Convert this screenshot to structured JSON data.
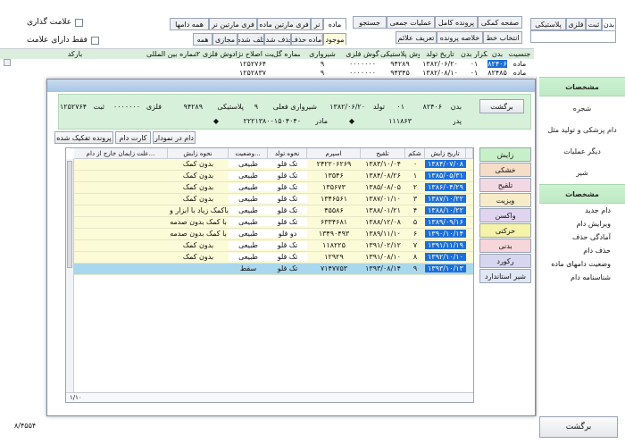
{
  "filters": {
    "tab_bar": [
      "بدن",
      "ثبت",
      "فلزی",
      "پلاستیکی"
    ],
    "tab2": [
      "صفحه کمکی",
      "پرونده کامل",
      "عملیات جمعی",
      "جستجو"
    ],
    "tab3": [
      "انتخاب خط",
      "خلاصه پرونده",
      "تعریف علائم"
    ],
    "scope": [
      "همه دامها",
      "فری مارتین نر",
      "فری مارتین ماده",
      "نر",
      "ماده"
    ],
    "scope2": [
      "همه",
      "مجازی",
      "تلف شده",
      "حذف شده",
      "آماده حذف",
      "موجود"
    ],
    "check1": "علامت گذاری",
    "check2": "فقط دارای علامت"
  },
  "top_grid": {
    "headers": [
      "جنسیت",
      "بدن",
      "تکرار بدن",
      "تاریخ تولد",
      "گوش پلاستیکی",
      "گوش فلزی",
      "شیرواری",
      "شماره گل",
      "ثبت اصلاح نژاد",
      "گوش فلزی ۲",
      "شماره بین المللی",
      "بارکد"
    ],
    "rows": [
      [
        "ماده",
        "۸۲۴۰۶",
        "۰۱",
        "۱۳۸۲/۰۶/۲۰",
        "۹۴۲۸۹",
        "۰۰۰۰۰۰۰",
        "۹",
        "",
        "۱۲۵۲۷۶۴",
        "",
        "",
        ""
      ],
      [
        "ماده",
        "۸۲۴۸۵",
        "۰۱",
        "۱۳۸۲/۰۸/۱۰",
        "۹۴۳۴۵",
        "۰۰۰۰۰۰۰",
        "۹",
        "",
        "۱۲۵۲۸۳۷",
        "",
        "",
        ""
      ]
    ]
  },
  "sidebar": {
    "items": [
      {
        "label": "مشخصات",
        "header": true
      },
      {
        "label": "شجره",
        "header": false
      },
      {
        "label": "دام پزشکی و تولید مثل",
        "header": false
      },
      {
        "label": "دیگر عملیات",
        "header": false
      },
      {
        "label": "شیر",
        "header": false
      },
      {
        "label": "مشخصات",
        "header": true
      }
    ],
    "links": [
      "دام جدید",
      "ویرایش دام",
      "آمادگی حذف",
      "حذف دام",
      "وضعیت دامهای ماده",
      "شناسنامه دام"
    ],
    "return": "برگشت"
  },
  "footer": {
    "count": "۸/۴۵۵۴"
  },
  "dialog": {
    "back": "برگشت",
    "info": {
      "row1": {
        "body_label": "بدن",
        "body": "۸۲۴۰۶",
        "rep": "۰۱",
        "birth_label": "تولد",
        "birth": "۱۳۸۲/۰۶/۲۰",
        "milk_label": "شیرواری فعلی",
        "milk": "۹",
        "plastic_label": "پلاستیکی",
        "plastic": "۹۴۲۸۹",
        "metal_label": "فلزی",
        "metal": "۰۰۰۰۰۰۰",
        "reg_label": "ثبت",
        "reg": "۱۲۵۲۷۶۴"
      },
      "row2": {
        "father_label": "پدر",
        "father": "۱۱۱۸۶۳",
        "mother_label": "مادر",
        "mother": "۲۲۲۱۳۸۰۰۱۵۰۴۰۴۰"
      }
    },
    "tabs": [
      "پرونده تفکیک شده",
      "کارت دام",
      "دام در نمودار"
    ],
    "columns": [
      "",
      "تاریخ زایش",
      "شکم",
      "تلقیح",
      "اسپرم",
      "نحوه تولد",
      "وضعیت...",
      "نحوه زایش",
      "علت زایمان خارج از دام..."
    ],
    "rows": [
      [
        "",
        "۱۳۸۴/۰۷/۰۸",
        "۰",
        "۱۳۸۳/۱۰/۰۴",
        "۲۴۲۲۰۶۲۶۹",
        "تک قلو",
        "طبیعی",
        "بدون کمک",
        ""
      ],
      [
        "",
        "۱۳۸۵/۰۵/۳۱",
        "۱",
        "۱۳۸۴/۰۸/۲۶",
        "۱۳۵۴۶",
        "تک قلو",
        "طبیعی",
        "بدون کمک",
        ""
      ],
      [
        "",
        "۱۳۸۶/۰۴/۲۹",
        "۲",
        "۱۳۸۵/۰۸/۰۵",
        "۱۳۵۶۷۳",
        "تک قلو",
        "طبیعی",
        "بدون کمک",
        ""
      ],
      [
        "",
        "۱۳۸۷/۱۰/۲۲",
        "۳",
        "۱۳۸۷/۰۱/۱۰",
        "۱۳۴۶۵۶۱",
        "تک قلو",
        "طبیعی",
        "بدون کمک",
        ""
      ],
      [
        "",
        "۱۳۸۸/۱۰/۲۲",
        "۴",
        "۱۳۸۸/۰۱/۲۱",
        "۴۵۵۸۶",
        "تک قلو",
        "طبیعی",
        "باکمک زیاد با ابزار و صدما",
        ""
      ],
      [
        "",
        "۱۳۸۹/۰۹/۱۶",
        "۵",
        "۱۳۸۸/۱۲/۰۸",
        "۶۳۳۴۶۸۱",
        "تک قلو",
        "طبیعی",
        "با کمک بدون صدمه",
        ""
      ],
      [
        "",
        "۱۳۹۰/۱۰/۱۴",
        "۶",
        "۱۳۸۹/۱۱/۱۰",
        "۱۳۴۹۰۴۹۳",
        "دو قلو",
        "طبیعی",
        "با کمک بدون صدمه",
        ""
      ],
      [
        "",
        "۱۳۹۱/۱۱/۱۹",
        "۷",
        "۱۳۹۱/۰۲/۱۲",
        "۱۱۸۲۲۵",
        "تک قلو",
        "طبیعی",
        "بدون کمک",
        ""
      ],
      [
        "",
        "۱۳۹۲/۱۰/۱۰",
        "۸",
        "۱۳۹۱/۰۸/۱۰",
        "۱۲۹۲۹",
        "تک قلو",
        "طبیعی",
        "بدون کمک",
        ""
      ],
      [
        "",
        "۱۳۹۳/۱۰/۱۳",
        "۹",
        "۱۳۹۳/۰۸/۱۴",
        "۷۱۴۷۷۵۳",
        "تک قلو",
        "سقط",
        "",
        ""
      ]
    ],
    "selected_row": 9,
    "pager": "۱/۱۰",
    "side_buttons": [
      {
        "label": "زایش",
        "color": "#c8f0c8"
      },
      {
        "label": "خشکی",
        "color": "#f6ddc8"
      },
      {
        "label": "تلقیح",
        "color": "#f1d8e2"
      },
      {
        "label": "ویزیت",
        "color": "#f6ecc8"
      },
      {
        "label": "واکسن",
        "color": "#e0d4ee"
      },
      {
        "label": "حرکتی",
        "color": "#f6f2a8"
      },
      {
        "label": "بدنی",
        "color": "#f6d6d8"
      },
      {
        "label": "رکورد",
        "color": "#d6d6ee"
      },
      {
        "label": "شیر استاندارد",
        "color": "#dfe6f4"
      }
    ]
  },
  "colors": {
    "selection": "#1d6fd8",
    "row_alt": "#fbfbd8",
    "side_green": "#c7efcc"
  }
}
